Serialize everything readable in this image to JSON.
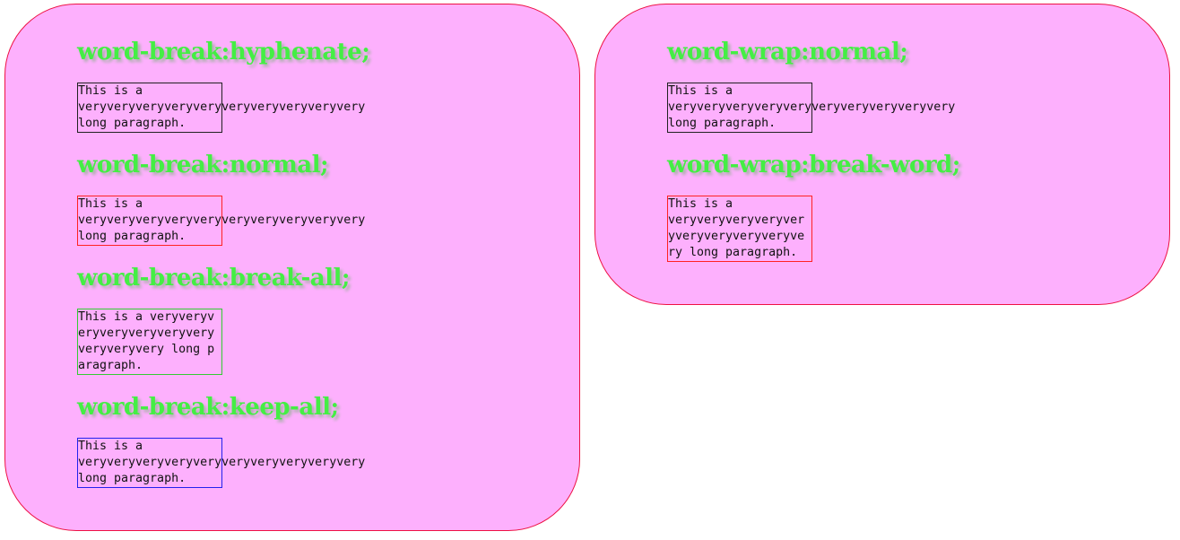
{
  "left_panel": {
    "sections": [
      {
        "heading": "word-break:hyphenate;",
        "text": "This is a veryveryveryveryveryveryveryveryveryvery long paragraph."
      },
      {
        "heading": "word-break:normal;",
        "text": "This is a veryveryveryveryveryveryveryveryveryvery long paragraph."
      },
      {
        "heading": "word-break:break-all;",
        "text": "This is a veryveryveryveryveryveryveryveryveryvery long paragraph."
      },
      {
        "heading": "word-break:keep-all;",
        "text": "This is a veryveryveryveryveryveryveryveryveryvery long paragraph."
      }
    ]
  },
  "right_panel": {
    "sections": [
      {
        "heading": "word-wrap:normal;",
        "text": "This is a veryveryveryveryveryveryveryveryveryvery long paragraph."
      },
      {
        "heading": "word-wrap:break-word;",
        "text": "This is a veryveryveryveryveryveryveryveryveryvery long paragraph."
      }
    ]
  },
  "colors": {
    "panel_background": "#fdb0fd",
    "panel_border": "#ee1144",
    "heading_color": "#44ee44",
    "border_hyphenate": "#222222",
    "border_normal": "#ff2222",
    "border_break_all": "#33cc33",
    "border_keep_all": "#2222ee"
  }
}
